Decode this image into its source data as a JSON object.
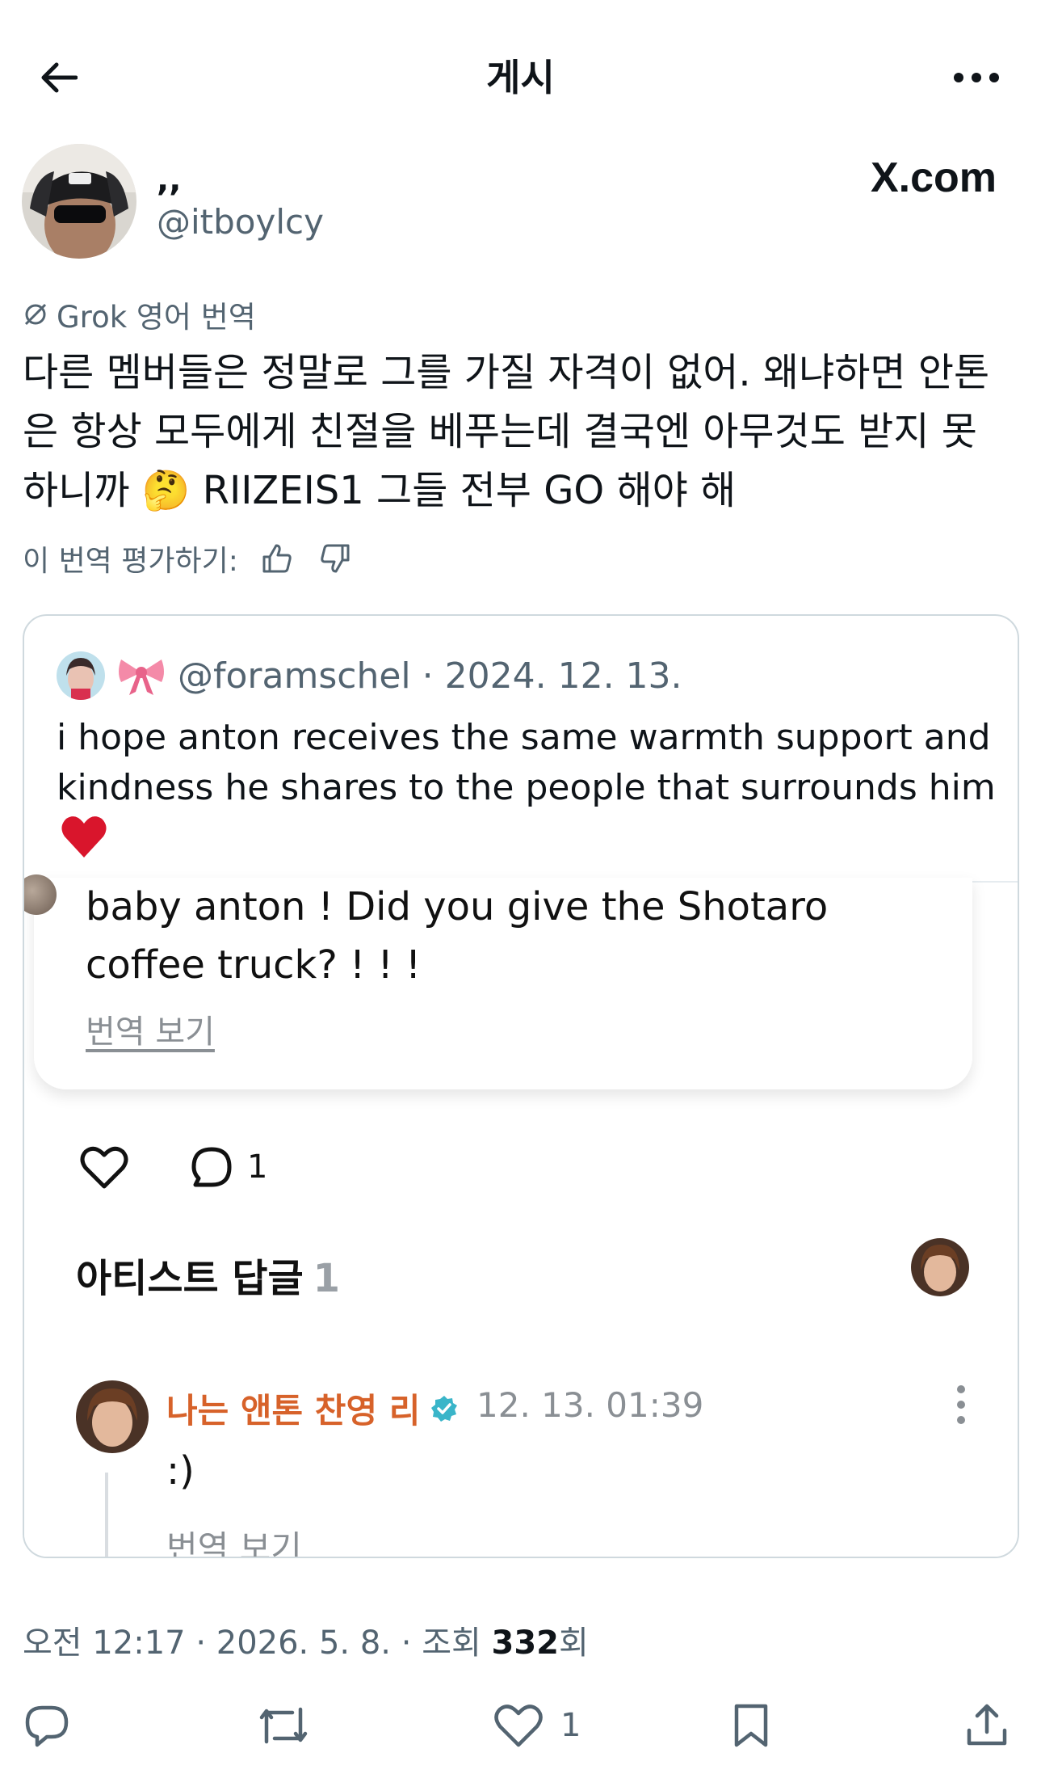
{
  "header": {
    "title": "게시"
  },
  "author": {
    "display_name": ",,",
    "handle": "@itboylcy",
    "badge": "X.com"
  },
  "translation": {
    "label": "Grok 영어 번역",
    "text": "다른 멤버들은 정말로 그를 가질 자격이 없어. 왜냐하면 안톤은 항상 모두에게 친절을 베푸는데 결국엔 아무것도 받지 못 하니까 🤔 RIIZEIS1 그들 전부 GO 해야 해",
    "rate_label": "이 번역 평가하기:"
  },
  "quote": {
    "handle": "@foramschel",
    "separator": "·",
    "date": "2024. 12. 13.",
    "text": "i hope anton receives the same warmth support and kindness he shares to the people that surrounds him",
    "heart": "❤️",
    "shot": {
      "comment": "baby anton ! Did you give the Shotaro coffee truck? !  !  !",
      "translate": "번역 보기",
      "comment_count": "1",
      "artist_title": "아티스트 답글",
      "artist_count": "1",
      "reply_name": "나는 앤톤 찬영 리",
      "reply_time": "12. 13. 01:39",
      "reply_text": ":)",
      "reply_translate": "번역 보기"
    }
  },
  "meta": {
    "time": "오전 12:17",
    "date": "2026. 5. 8.",
    "views_label_prefix": "조회",
    "views": "332",
    "views_suffix": "회"
  },
  "actions": {
    "like_count": "1"
  },
  "colors": {
    "text": "#0f1419",
    "muted": "#536471",
    "border": "#cfd9de",
    "artist_orange": "#d7622a",
    "verified": "#3ab5c9"
  },
  "icons": [
    "back-arrow-icon",
    "more-icon",
    "grok-icon",
    "thumbs-up-icon",
    "thumbs-down-icon",
    "bow-icon",
    "heart-icon",
    "comment-icon",
    "verified-icon",
    "reply-icon",
    "repost-icon",
    "like-icon",
    "bookmark-icon",
    "share-icon"
  ]
}
